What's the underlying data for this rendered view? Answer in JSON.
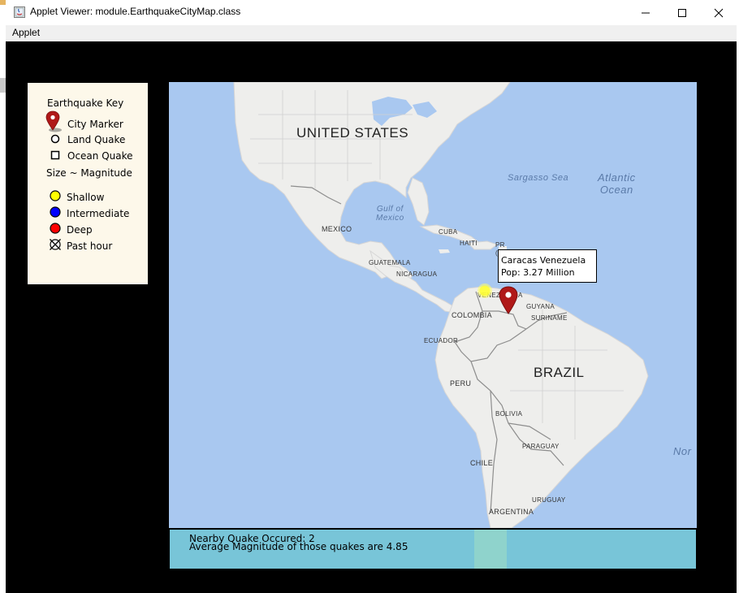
{
  "window": {
    "title": "Applet Viewer: module.EarthquakeCityMap.class",
    "controls": {
      "minimize": "–",
      "maximize": "☐",
      "close": "✕"
    }
  },
  "menu": {
    "items": [
      "Applet"
    ]
  },
  "legend": {
    "title": "Earthquake Key",
    "city_marker": "City Marker",
    "land_quake": "Land Quake",
    "ocean_quake": "Ocean Quake",
    "size_note": "Size ~ Magnitude",
    "shallow": "Shallow",
    "intermediate": "Intermediate",
    "deep": "Deep",
    "past_hour": "Past hour",
    "colors": {
      "shallow": "#ffff00",
      "intermediate": "#0000ff",
      "deep": "#ff0000",
      "city": "#b01818"
    }
  },
  "map": {
    "labels": {
      "united_states": "UNITED STATES",
      "mexico": "MEXICO",
      "gulf": "Gulf of\nMexico",
      "sargasso": "Sargasso Sea",
      "atlantic": "Atlantic\nOcean",
      "cuba": "CUBA",
      "haiti": "HAITI",
      "pr": "PR\n(U",
      "guatemala": "GUATEMALA",
      "nicaragua": "NICARAGUA",
      "venezuela": "VENEZ",
      "venezuela_tail": "A",
      "guyana": "GUYANA",
      "suriname": "SURINAME",
      "colombia": "COLOMBIA",
      "ecuador": "ECUADOR",
      "brazil": "BRAZIL",
      "peru": "PERU",
      "bolivia": "BOLIVIA",
      "paraguay": "PARAGUAY",
      "chile": "CHILE",
      "uruguay": "URUGUAY",
      "argentina": "ARGENTINA",
      "north": "Nor"
    }
  },
  "tooltip": {
    "line1": "Caracas Venezuela",
    "line2": "Pop: 3.27 Million"
  },
  "info": {
    "line1": "Nearby Quake Occured: 2",
    "line2": "Average Magnitude of those quakes are 4.85"
  }
}
